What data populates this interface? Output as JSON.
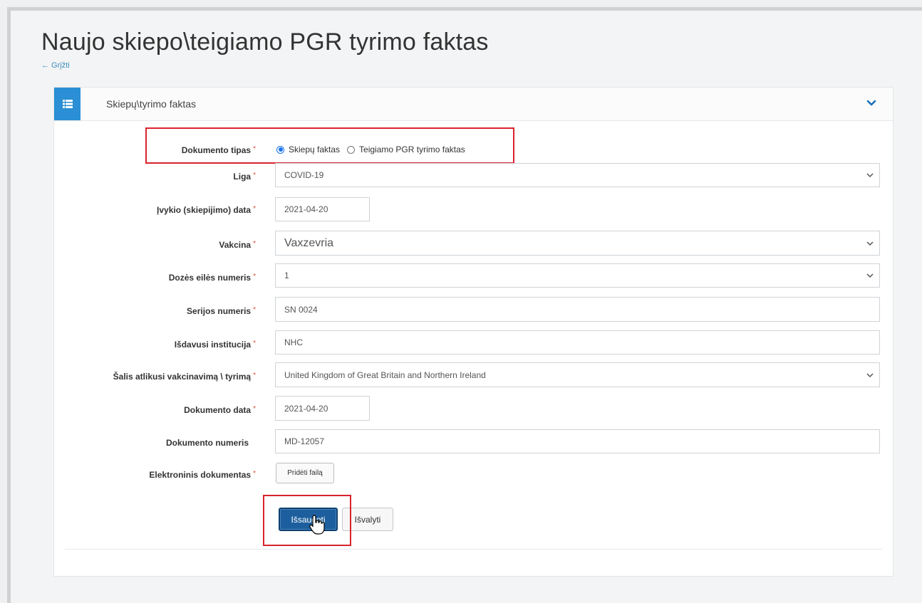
{
  "page": {
    "title": "Naujo skiepo\\teigiamo PGR tyrimo faktas",
    "back_link": "← Grįžti"
  },
  "panel": {
    "title": "Skiepų\\tyrimo faktas",
    "icon": "list-icon",
    "collapse_icon": "chevron-down-icon"
  },
  "form": {
    "required_mark": "*",
    "document_type": {
      "label": "Dokumento tipas",
      "options": [
        "Skiepų faktas",
        "Teigiamo PGR tyrimo faktas"
      ],
      "selected": "Skiepų faktas"
    },
    "disease": {
      "label": "Liga",
      "value": "COVID-19"
    },
    "event_date": {
      "label": "Įvykio (skiepijimo) data",
      "value": "2021-04-20"
    },
    "vaccine": {
      "label": "Vakcina",
      "value": "Vaxzevria"
    },
    "dose_number": {
      "label": "Dozės eilės numeris",
      "value": "1"
    },
    "series_number": {
      "label": "Serijos numeris",
      "value": "SN 0024"
    },
    "issuing_institution": {
      "label": "Išdavusi institucija",
      "value": "NHC"
    },
    "country": {
      "label": "Šalis atlikusi vakcinavimą \\ tyrimą",
      "value": "United Kingdom of Great Britain and Northern Ireland"
    },
    "document_date": {
      "label": "Dokumento data",
      "value": "2021-04-20"
    },
    "document_number": {
      "label": "Dokumento numeris",
      "value": "MD-12057"
    },
    "electronic_document": {
      "label": "Elektroninis dokumentas",
      "button": "Pridėti failą"
    }
  },
  "actions": {
    "save": "Išsaugoti",
    "clear": "Išvalyti"
  },
  "colors": {
    "accent": "#2a8fd4",
    "highlight": "#d9232e",
    "primary_button": "#1d5f9e",
    "required": "#dd4b39"
  }
}
